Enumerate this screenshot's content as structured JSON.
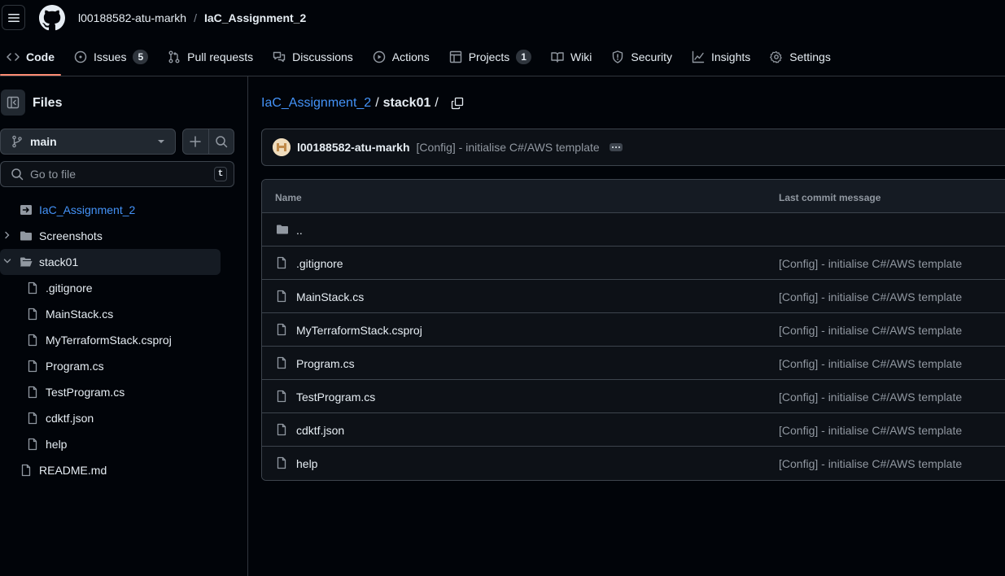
{
  "header": {
    "owner": "l00188582-atu-markh",
    "separator": "/",
    "repo": "IaC_Assignment_2"
  },
  "tabs": [
    {
      "label": "Code",
      "icon": "code-icon",
      "active": true
    },
    {
      "label": "Issues",
      "icon": "issue-opened-icon",
      "count": "5"
    },
    {
      "label": "Pull requests",
      "icon": "git-pull-request-icon"
    },
    {
      "label": "Discussions",
      "icon": "comment-discussion-icon"
    },
    {
      "label": "Actions",
      "icon": "play-icon"
    },
    {
      "label": "Projects",
      "icon": "table-icon",
      "count": "1"
    },
    {
      "label": "Wiki",
      "icon": "book-icon"
    },
    {
      "label": "Security",
      "icon": "shield-icon"
    },
    {
      "label": "Insights",
      "icon": "graph-icon"
    },
    {
      "label": "Settings",
      "icon": "gear-icon"
    }
  ],
  "sidebar": {
    "title": "Files",
    "branch": "main",
    "goto_placeholder": "Go to file",
    "goto_shortcut": "t",
    "tree": [
      {
        "name": "IaC_Assignment_2",
        "type": "root",
        "depth": 0
      },
      {
        "name": "Screenshots",
        "type": "folder",
        "expanded": false,
        "depth": 0
      },
      {
        "name": "stack01",
        "type": "folder",
        "expanded": true,
        "selected": true,
        "depth": 0
      },
      {
        "name": ".gitignore",
        "type": "file",
        "depth": 1
      },
      {
        "name": "MainStack.cs",
        "type": "file",
        "depth": 1
      },
      {
        "name": "MyTerraformStack.csproj",
        "type": "file",
        "depth": 1
      },
      {
        "name": "Program.cs",
        "type": "file",
        "depth": 1
      },
      {
        "name": "TestProgram.cs",
        "type": "file",
        "depth": 1
      },
      {
        "name": "cdktf.json",
        "type": "file",
        "depth": 1
      },
      {
        "name": "help",
        "type": "file",
        "depth": 1
      },
      {
        "name": "README.md",
        "type": "file",
        "depth": 0
      }
    ]
  },
  "main": {
    "path": {
      "repo": "IaC_Assignment_2",
      "sep1": "/",
      "current": "stack01",
      "sep2": "/"
    },
    "commit": {
      "author": "l00188582-atu-markh",
      "message": "[Config] - initialise C#/AWS template"
    },
    "table": {
      "col_name": "Name",
      "col_message": "Last commit message",
      "parent_row": "..",
      "rows": [
        {
          "name": ".gitignore",
          "message": "[Config] - initialise C#/AWS template"
        },
        {
          "name": "MainStack.cs",
          "message": "[Config] - initialise C#/AWS template"
        },
        {
          "name": "MyTerraformStack.csproj",
          "message": "[Config] - initialise C#/AWS template"
        },
        {
          "name": "Program.cs",
          "message": "[Config] - initialise C#/AWS template"
        },
        {
          "name": "TestProgram.cs",
          "message": "[Config] - initialise C#/AWS template"
        },
        {
          "name": "cdktf.json",
          "message": "[Config] - initialise C#/AWS template"
        },
        {
          "name": "help",
          "message": "[Config] - initialise C#/AWS template"
        }
      ]
    }
  },
  "colors": {
    "background": "#010409",
    "surface": "#0d1117",
    "border": "#3d444d",
    "text": "#e6edf3",
    "muted": "#9198a1",
    "link": "#4493f8",
    "active_tab_underline": "#fd8c73"
  }
}
